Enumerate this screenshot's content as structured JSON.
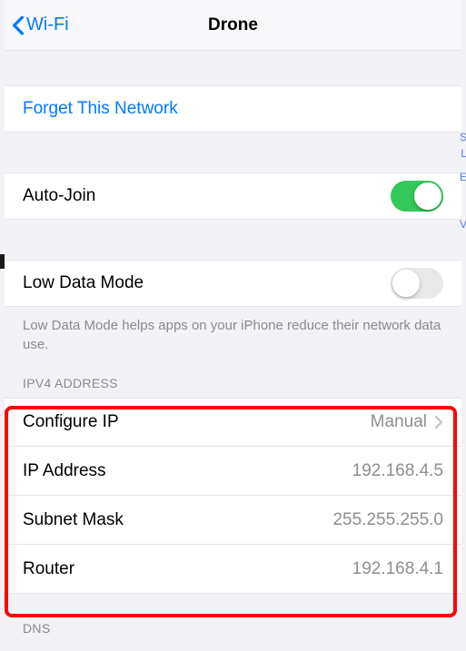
{
  "navbar": {
    "back_label": "Wi-Fi",
    "title": "Drone"
  },
  "actions": {
    "forget": "Forget This Network"
  },
  "auto_join": {
    "label": "Auto-Join",
    "on": true
  },
  "low_data": {
    "label": "Low Data Mode",
    "on": false,
    "footer": "Low Data Mode helps apps on your iPhone reduce their network data use."
  },
  "ipv4": {
    "header": "IPV4 ADDRESS",
    "configure": {
      "label": "Configure IP",
      "value": "Manual"
    },
    "ip": {
      "label": "IP Address",
      "value": "192.168.4.5"
    },
    "subnet": {
      "label": "Subnet Mask",
      "value": "255.255.255.0"
    },
    "router": {
      "label": "Router",
      "value": "192.168.4.1"
    }
  },
  "dns": {
    "header": "DNS"
  },
  "edge_letters": {
    "s": "S",
    "l": "L",
    "e": "E",
    "v": "V"
  }
}
